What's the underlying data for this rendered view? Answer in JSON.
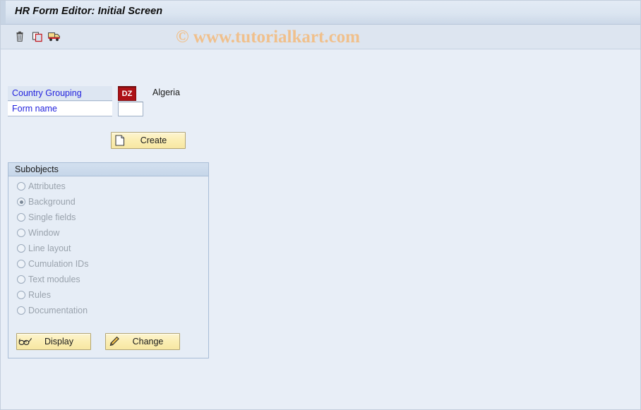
{
  "window": {
    "title": "HR Form Editor: Initial Screen"
  },
  "watermark": {
    "text": "© www.tutorialkart.com"
  },
  "toolbar": {
    "items": [
      {
        "name": "delete-icon",
        "tooltip": "Delete"
      },
      {
        "name": "copy-icon",
        "tooltip": "Copy"
      },
      {
        "name": "transport-icon",
        "tooltip": "Transport"
      }
    ]
  },
  "form": {
    "country_grouping": {
      "label": "Country Grouping",
      "value": "DZ",
      "placeholder": "",
      "description": "Algeria"
    },
    "form_name": {
      "label": "Form name",
      "value": "",
      "placeholder": ""
    },
    "create_button": {
      "label": "Create",
      "icon": "new-document-icon"
    }
  },
  "subobjects": {
    "title": "Subobjects",
    "selected": "Background",
    "options": [
      {
        "label": "Attributes",
        "selected": false
      },
      {
        "label": "Background",
        "selected": true
      },
      {
        "label": "Single fields",
        "selected": false
      },
      {
        "label": "Window",
        "selected": false
      },
      {
        "label": "Line layout",
        "selected": false
      },
      {
        "label": "Cumulation IDs",
        "selected": false
      },
      {
        "label": "Text modules",
        "selected": false
      },
      {
        "label": "Rules",
        "selected": false
      },
      {
        "label": "Documentation",
        "selected": false
      }
    ],
    "display_button": {
      "label": "Display",
      "icon": "glasses-icon"
    },
    "change_button": {
      "label": "Change",
      "icon": "pencil-icon"
    }
  },
  "colors": {
    "page_background": "#e8eef7",
    "title_bar": "#dbe5f1",
    "label_text": "#2222dd",
    "required_field_background": "#ad1116",
    "button_yellow": "#fbeeb4",
    "watermark": "#f0c08c"
  }
}
